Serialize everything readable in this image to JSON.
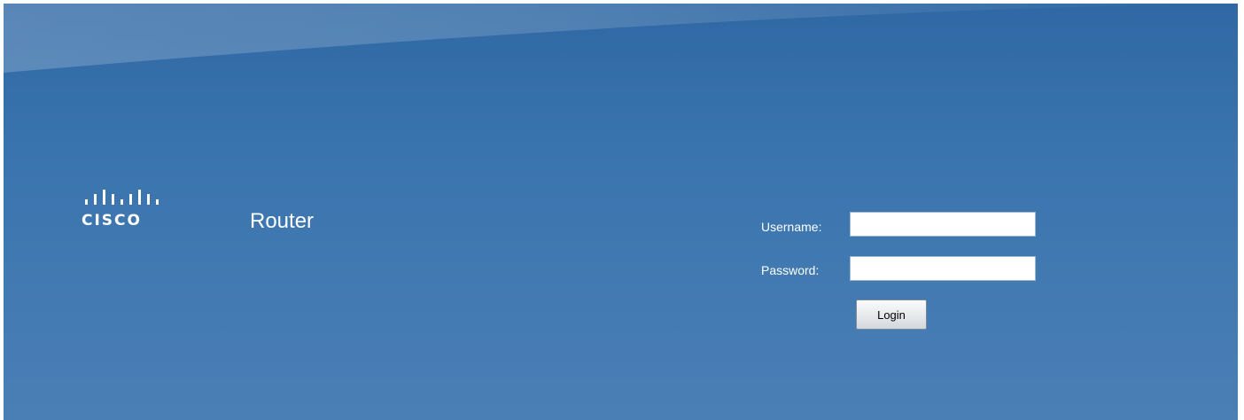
{
  "brand": {
    "logo_icon": "cisco-logo",
    "logo_text": "CISCO",
    "product_title": "Router"
  },
  "login": {
    "username_label": "Username:",
    "username_value": "",
    "password_label": "Password:",
    "password_value": "",
    "login_button_label": "Login"
  },
  "colors": {
    "background_top": "#2f68a4",
    "background_bottom": "#4a7fb5",
    "text": "#ffffff"
  }
}
